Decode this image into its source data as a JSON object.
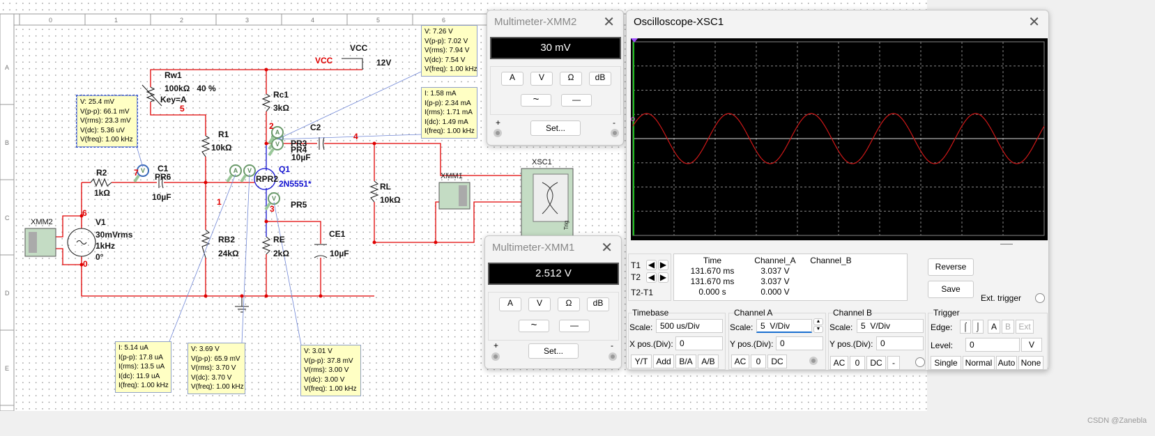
{
  "ruler": {
    "cols": [
      "0",
      "1",
      "2",
      "3",
      "4",
      "5",
      "6"
    ],
    "rows": [
      "A",
      "B",
      "C",
      "D",
      "E"
    ]
  },
  "schematic": {
    "vcc_net": "VCC",
    "vcc_symbol": "VCC",
    "vcc_value": "12V",
    "rw1": {
      "name": "Rw1",
      "value": "100kΩ   40 %",
      "key": "Key=A"
    },
    "rc1": {
      "name": "Rc1",
      "value": "3kΩ"
    },
    "r1": {
      "name": "R1",
      "value": "10kΩ"
    },
    "r2": {
      "name": "R2",
      "value": "1kΩ"
    },
    "rb2": {
      "name": "RB2",
      "value": "24kΩ"
    },
    "re": {
      "name": "RE",
      "value": "2kΩ"
    },
    "rl": {
      "name": "RL",
      "value": "10kΩ"
    },
    "c1": {
      "name": "C1",
      "probe": "PR6",
      "value": "10µF"
    },
    "c2": {
      "name": "C2",
      "value": "10µF",
      "probe_a": "PR3",
      "probe_b": "PR4"
    },
    "ce1": {
      "name": "CE1",
      "value": "10µF"
    },
    "q1": {
      "name": "Q1",
      "model": "2N5551*",
      "probe": "RPR2"
    },
    "v1": {
      "name": "V1",
      "amp": "30mVrms",
      "freq": "1kHz",
      "phase": "0°"
    },
    "pr5": "PR5",
    "xmm1": "XMM1",
    "xmm2": "XMM2",
    "xsc1": "XSC1",
    "trig": "Trig",
    "nodes": [
      "0",
      "1",
      "2",
      "3",
      "4",
      "5",
      "6",
      "7"
    ],
    "probe_letters": {
      "v": "V",
      "a": "A"
    }
  },
  "tooltips": [
    [
      "V: 25.4 mV",
      "V(p-p): 66.1 mV",
      "V(rms): 23.3 mV",
      "V(dc): 5.36 uV",
      "V(freq): 1.00 kHz"
    ],
    [
      "V: 7.26 V",
      "V(p-p): 7.02 V",
      "V(rms): 7.94 V",
      "V(dc): 7.54 V",
      "V(freq): 1.00 kHz"
    ],
    [
      "I: 1.58 mA",
      "I(p-p): 2.34 mA",
      "I(rms): 1.71 mA",
      "I(dc): 1.49 mA",
      "I(freq): 1.00 kHz"
    ],
    [
      "I: 5.14 uA",
      "I(p-p): 17.8 uA",
      "I(rms): 13.5 uA",
      "I(dc): 11.9 uA",
      "I(freq): 1.00 kHz"
    ],
    [
      "V: 3.69 V",
      "V(p-p): 65.9 mV",
      "V(rms): 3.70 V",
      "V(dc): 3.70 V",
      "V(freq): 1.00 kHz"
    ],
    [
      "V: 3.01 V",
      "V(p-p): 37.8 mV",
      "V(rms): 3.00 V",
      "V(dc): 3.00 V",
      "V(freq): 1.00 kHz"
    ]
  ],
  "xmm2_window": {
    "title": "Multimeter-XMM2",
    "display": "30 mV",
    "buttons": [
      "A",
      "V",
      "Ω",
      "dB"
    ],
    "set": "Set...",
    "plus": "+",
    "minus": "-",
    "ac": "~",
    "dc": "—"
  },
  "xmm1_window": {
    "title": "Multimeter-XMM1",
    "display": "2.512 V",
    "buttons": [
      "A",
      "V",
      "Ω",
      "dB"
    ],
    "set": "Set...",
    "plus": "+",
    "minus": "-",
    "ac": "~",
    "dc": "—"
  },
  "scope": {
    "title": "Oscilloscope-XSC1",
    "trace_color": "#d01818",
    "cursor_labels": [
      "T1",
      "T2",
      "T2-T1"
    ],
    "table": {
      "headers": [
        "Time",
        "Channel_A",
        "Channel_B"
      ],
      "rows": [
        [
          "131.670 ms",
          "3.037 V",
          ""
        ],
        [
          "131.670 ms",
          "3.037 V",
          ""
        ],
        [
          "0.000 s",
          "0.000 V",
          ""
        ]
      ]
    },
    "reverse": "Reverse",
    "save": "Save",
    "ext_trigger": "Ext. trigger",
    "timebase": {
      "title": "Timebase",
      "scale_label": "Scale:",
      "scale": "500 us/Div",
      "pos_label": "X pos.(Div):",
      "pos": "0",
      "buttons": [
        "Y/T",
        "Add",
        "B/A",
        "A/B"
      ]
    },
    "channel_a": {
      "title": "Channel A",
      "scale_label": "Scale:",
      "scale": "5  V/Div",
      "pos_label": "Y pos.(Div):",
      "pos": "0",
      "buttons": [
        "AC",
        "0",
        "DC"
      ]
    },
    "channel_b": {
      "title": "Channel B",
      "scale_label": "Scale:",
      "scale": "5  V/Div",
      "pos_label": "Y pos.(Div):",
      "pos": "0",
      "buttons": [
        "AC",
        "0",
        "DC",
        "-"
      ]
    },
    "trigger": {
      "title": "Trigger",
      "edge_label": "Edge:",
      "level_label": "Level:",
      "level": "0",
      "unit": "V",
      "edge_buttons": [
        "A",
        "B",
        "Ext"
      ],
      "modes": [
        "Single",
        "Normal",
        "Auto",
        "None"
      ]
    }
  },
  "watermark": "CSDN @Zanebla"
}
